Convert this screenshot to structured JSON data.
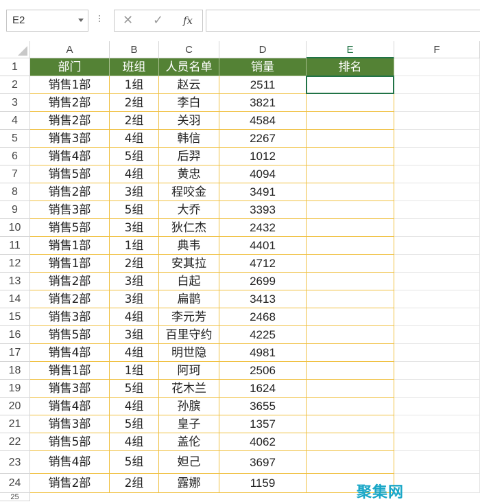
{
  "formula_bar": {
    "name_box": "E2",
    "cancel_icon": "✕",
    "enter_icon": "✓",
    "fx_label": "fx",
    "formula": ""
  },
  "columns": [
    "A",
    "B",
    "C",
    "D",
    "E",
    "F"
  ],
  "selected_column": "E",
  "selected_row": 2,
  "table_header": [
    "部门",
    "班组",
    "人员名单",
    "销量",
    "排名"
  ],
  "rows": [
    [
      "销售1部",
      "1组",
      "赵云",
      "2511",
      ""
    ],
    [
      "销售2部",
      "2组",
      "李白",
      "3821",
      ""
    ],
    [
      "销售2部",
      "2组",
      "关羽",
      "4584",
      ""
    ],
    [
      "销售3部",
      "4组",
      "韩信",
      "2267",
      ""
    ],
    [
      "销售4部",
      "5组",
      "后羿",
      "1012",
      ""
    ],
    [
      "销售5部",
      "4组",
      "黄忠",
      "4094",
      ""
    ],
    [
      "销售2部",
      "3组",
      "程咬金",
      "3491",
      ""
    ],
    [
      "销售3部",
      "5组",
      "大乔",
      "3393",
      ""
    ],
    [
      "销售5部",
      "3组",
      "狄仁杰",
      "2432",
      ""
    ],
    [
      "销售1部",
      "1组",
      "典韦",
      "4401",
      ""
    ],
    [
      "销售1部",
      "2组",
      "安其拉",
      "4712",
      ""
    ],
    [
      "销售2部",
      "3组",
      "白起",
      "2699",
      ""
    ],
    [
      "销售2部",
      "3组",
      "扁鹊",
      "3413",
      ""
    ],
    [
      "销售3部",
      "4组",
      "李元芳",
      "2468",
      ""
    ],
    [
      "销售5部",
      "3组",
      "百里守约",
      "4225",
      ""
    ],
    [
      "销售4部",
      "4组",
      "明世隐",
      "4981",
      ""
    ],
    [
      "销售1部",
      "1组",
      "阿珂",
      "2506",
      ""
    ],
    [
      "销售3部",
      "5组",
      "花木兰",
      "1624",
      ""
    ],
    [
      "销售4部",
      "4组",
      "孙膑",
      "3655",
      ""
    ],
    [
      "销售3部",
      "5组",
      "皇子",
      "1357",
      ""
    ],
    [
      "销售5部",
      "4组",
      "盖伦",
      "4062",
      ""
    ],
    [
      "销售4部",
      "5组",
      "妲己",
      "3697",
      ""
    ],
    [
      "销售2部",
      "2组",
      "露娜",
      "1159",
      ""
    ]
  ],
  "watermark": "聚集网",
  "colors": {
    "header_fill": "#548235",
    "header_text": "#ffffff",
    "cell_border": "#f0c040",
    "selection": "#217346"
  }
}
